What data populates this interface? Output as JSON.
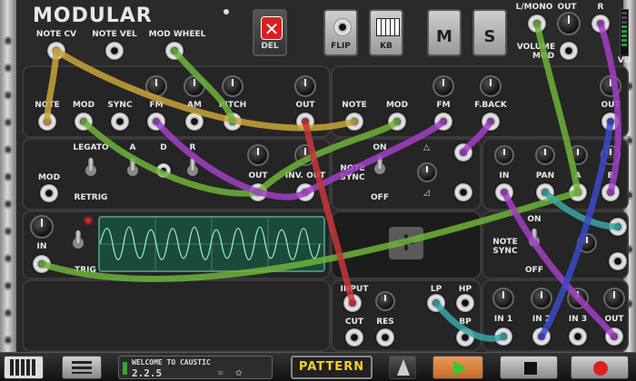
{
  "app": {
    "title": "MODULAR"
  },
  "top_buttons": {
    "del": "DEL",
    "flip": "FLIP",
    "kb": "KB",
    "m": "M",
    "s": "S"
  },
  "top_left_labels": {
    "note_cv": "NOTE CV",
    "note_vel": "NOTE VEL",
    "mod_wheel": "MOD WHEEL"
  },
  "output_section": {
    "l_mono": "L/MONO",
    "out": "OUT",
    "r": "R",
    "volume": "VOLUME",
    "mod": "MOD",
    "vu": "VU"
  },
  "osc1": {
    "note": "NOTE",
    "mod": "MOD",
    "sync": "SYNC",
    "fm": "FM",
    "am": "AM",
    "pitch": "PITCH",
    "out": "OUT"
  },
  "osc2": {
    "note": "NOTE",
    "mod": "MOD",
    "fm": "FM",
    "fback": "F.BACK",
    "out": "OUT"
  },
  "envelope": {
    "mod": "MOD",
    "legato": "LEGATO",
    "retrig": "RETRIG",
    "a": "A",
    "d": "D",
    "r": "R",
    "out": "OUT",
    "inv_out": "INV. OUT"
  },
  "lfo_note_sync": {
    "on": "ON",
    "note_sync": "NOTE SYNC",
    "off": "OFF"
  },
  "mixer": {
    "in": "IN",
    "pan": "PAN",
    "a": "A",
    "b": "B"
  },
  "lfo2": {
    "on": "ON",
    "note_sync": "NOTE SYNC",
    "off": "OFF"
  },
  "scope": {
    "in": "IN",
    "trig": "TRIG"
  },
  "filter": {
    "input": "INPUT",
    "cut": "CUT",
    "res": "RES",
    "lp": "LP",
    "hp": "HP",
    "bp": "BP"
  },
  "mixer4": {
    "in1": "IN 1",
    "in2": "IN 2",
    "in3": "IN 3",
    "out": "OUT"
  },
  "bottom_bar": {
    "lcd_line1": "WELCOME TO CAUSTIC",
    "lcd_line2": "2.2.5",
    "pattern": "PATTERN"
  },
  "colors": {
    "cable_yellow": "#c8a53a",
    "cable_green": "#6db33a",
    "cable_purple": "#a13fc4",
    "cable_red": "#c8363a",
    "cable_teal": "#3aa6a6",
    "cable_blue": "#3a4ac8",
    "scope_bg": "#1b4a3a",
    "pattern_text": "#f2d21a"
  }
}
